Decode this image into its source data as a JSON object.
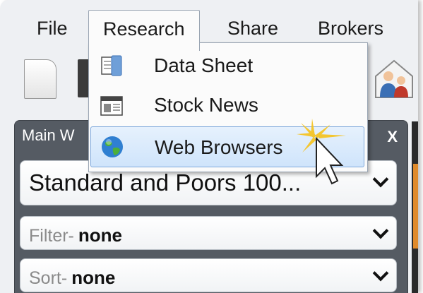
{
  "menubar": {
    "file": "File",
    "research": "Research",
    "share": "Share",
    "brokers": "Brokers"
  },
  "research_menu": {
    "items": [
      {
        "label": "Data Sheet",
        "icon": "data-sheet-icon"
      },
      {
        "label": "Stock News",
        "icon": "stock-news-icon"
      },
      {
        "label": "Web Browsers",
        "icon": "globe-icon",
        "highlighted": true
      }
    ]
  },
  "main_window": {
    "title": "Main W",
    "close": "X",
    "index_select": {
      "value": "Standard and Poors 100..."
    },
    "filter": {
      "label": "Filter-",
      "value": "none"
    },
    "sort": {
      "label": "Sort-",
      "value": "none"
    }
  },
  "colors": {
    "highlight_bg": "#cfe4fb",
    "highlight_border": "#7fa9dc",
    "panel_header": "#555b63",
    "accent_orange": "#e08a2a"
  }
}
